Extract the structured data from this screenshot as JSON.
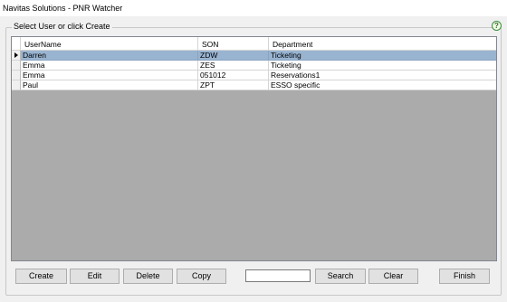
{
  "window": {
    "title": "Navitas Solutions - PNR Watcher"
  },
  "group": {
    "label": "Select User or click Create",
    "help_icon": "?"
  },
  "grid": {
    "columns": [
      "UserName",
      "SON",
      "Department"
    ],
    "rows": [
      {
        "username": "Darren",
        "son": "ZDW",
        "department": "Ticketing",
        "selected": true
      },
      {
        "username": "Emma",
        "son": "ZES",
        "department": "Ticketing",
        "selected": false
      },
      {
        "username": "Emma",
        "son": "051012",
        "department": "Reservations1",
        "selected": false
      },
      {
        "username": "Paul",
        "son": "ZPT",
        "department": "ESSO specific",
        "selected": false
      }
    ],
    "selection_color": "#99b4d1",
    "empty_area_color": "#ababab"
  },
  "buttons": {
    "create": "Create",
    "edit": "Edit",
    "delete": "Delete",
    "copy": "Copy",
    "search": "Search",
    "clear": "Clear",
    "finish": "Finish"
  },
  "search": {
    "value": ""
  }
}
